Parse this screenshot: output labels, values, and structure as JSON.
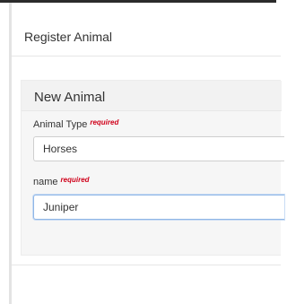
{
  "dialog": {
    "title": "Register Animal"
  },
  "form": {
    "section_title": "New Animal",
    "fields": [
      {
        "label": "Animal Type",
        "required_text": "required",
        "value": "Horses"
      },
      {
        "label": "name",
        "required_text": "required",
        "value": "Juniper"
      }
    ]
  },
  "colors": {
    "required": "#d0021b",
    "focus_border": "#8fb6e6"
  }
}
